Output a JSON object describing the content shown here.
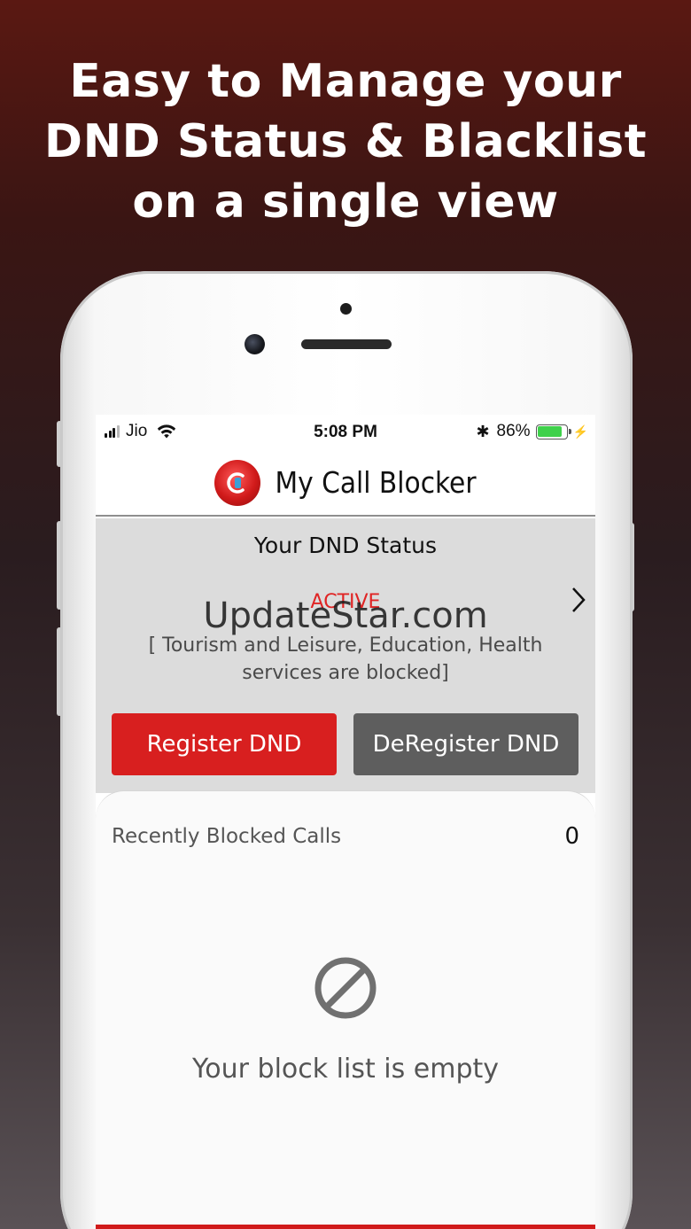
{
  "headline": {
    "line1": "Easy to Manage your",
    "line2": "DND Status & Blacklist",
    "line3": "on a single view"
  },
  "statusbar": {
    "carrier": "Jio",
    "time": "5:08 PM",
    "battery_percent": "86%",
    "battery_level": 0.86,
    "signal_bars_filled": 3,
    "signal_bars_total": 4
  },
  "app": {
    "title": "My Call Blocker"
  },
  "dnd": {
    "heading": "Your DND Status",
    "status": "ACTIVE",
    "description": "[ Tourism and Leisure, Education,  Health services are blocked]",
    "register_label": "Register DND",
    "deregister_label": "DeRegister DND"
  },
  "blocked": {
    "label": "Recently Blocked Calls",
    "count": "0",
    "empty_message": "Your block list is empty"
  },
  "watermark": "UpdateStar.com",
  "colors": {
    "accent_red": "#d81f1f",
    "dnd_active_red": "#e02424",
    "deregister_gray": "#5e5e5e",
    "battery_green": "#3fd14b"
  }
}
